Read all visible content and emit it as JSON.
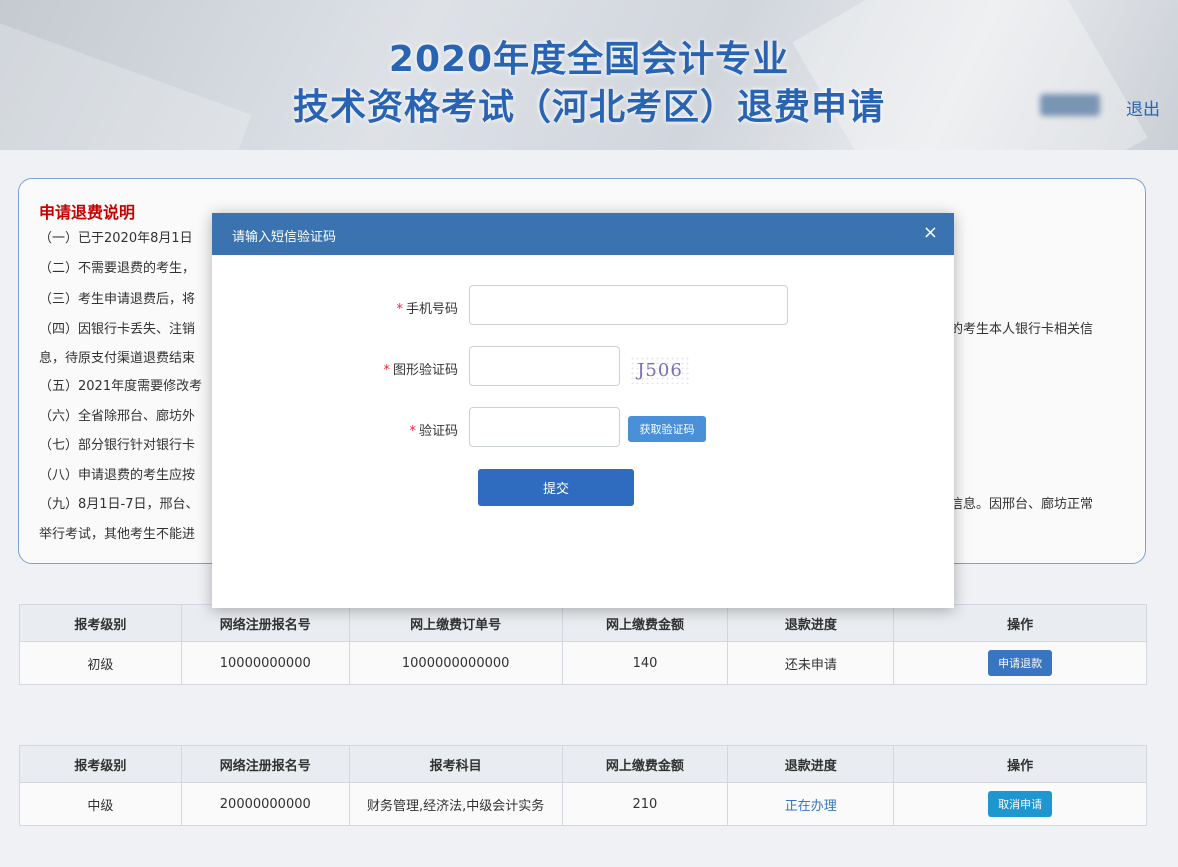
{
  "header": {
    "title_line1": "2020年度全国会计专业",
    "title_line2": "技术资格考试（河北考区）退费申请",
    "logout": "退出"
  },
  "notice": {
    "title": "申请退费说明",
    "lines": [
      "（一）已于2020年8月1日",
      "（二）不需要退费的考生，",
      "（三）考生申请退费后，将",
      "（四）因银行卡丢失、注销",
      "息，待原支付渠道退费结束",
      "（五）2021年度需要修改考",
      "（六）全省除邢台、廊坊外",
      "（七）部分银行针对银行卡",
      "（八）申请退费的考生应按",
      "（九）8月1日-7日，邢台、",
      "举行考试，其他考生不能进"
    ],
    "right_fragments": [
      "明的考生本人银行卡相关信",
      "关信息。因邢台、廊坊正常"
    ]
  },
  "table1": {
    "headers": [
      "报考级别",
      "网络注册报名号",
      "网上缴费订单号",
      "网上缴费金额",
      "退款进度",
      "操作"
    ],
    "row": {
      "level": "初级",
      "reg_no": "10000000000",
      "order_no": "1000000000000",
      "amount": "140",
      "progress": "还未申请",
      "action": "申请退款"
    }
  },
  "table2": {
    "headers": [
      "报考级别",
      "网络注册报名号",
      "报考科目",
      "网上缴费金额",
      "退款进度",
      "操作"
    ],
    "row": {
      "level": "中级",
      "reg_no": "20000000000",
      "subjects": "财务管理,经济法,中级会计实务",
      "amount": "210",
      "progress": "正在办理",
      "action": "取消申请"
    }
  },
  "modal": {
    "title": "请输入短信验证码",
    "close": "×",
    "required_mark": "*",
    "phone_label": "手机号码",
    "phone_value": "",
    "captcha_label": "图形验证码",
    "captcha_value": "",
    "captcha_image_text": "J506",
    "code_label": "验证码",
    "code_value": "",
    "get_code": "获取验证码",
    "submit": "提交"
  },
  "colors": {
    "brand_blue": "#2a66b8",
    "modal_header": "#3a73b0",
    "notice_title": "#cc0000"
  }
}
